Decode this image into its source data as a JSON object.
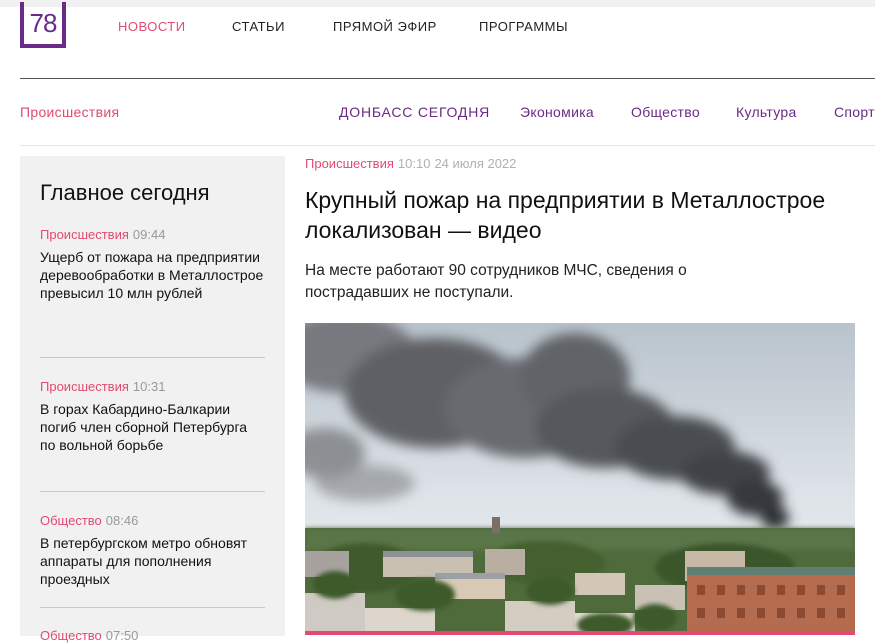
{
  "logo": {
    "text": "78"
  },
  "top_nav": [
    {
      "label": "НОВОСТИ",
      "active": true
    },
    {
      "label": "СТАТЬИ",
      "active": false
    },
    {
      "label": "ПРЯМОЙ ЭФИР",
      "active": false
    },
    {
      "label": "ПРОГРАММЫ",
      "active": false
    }
  ],
  "section_nav": {
    "current": "Происшествия",
    "items": [
      "ДОНБАСС СЕГОДНЯ",
      "Экономика",
      "Общество",
      "Культура",
      "Спорт"
    ]
  },
  "sidebar": {
    "title": "Главное сегодня",
    "items": [
      {
        "category": "Происшествия",
        "time": "09:44",
        "title": "Ущерб от пожара на предприятии деревообработки в Металлострое превысил 10 млн рублей"
      },
      {
        "category": "Происшествия",
        "time": "10:31",
        "title": "В горах Кабардино-Балкарии погиб член сборной Петербурга по вольной борьбе"
      },
      {
        "category": "Общество",
        "time": "08:46",
        "title": "В петербургском метро обновят аппараты для пополнения проездных"
      },
      {
        "category": "Общество",
        "time": "07:50",
        "title": ""
      }
    ]
  },
  "article": {
    "category": "Происшествия",
    "time": "10:10",
    "date": "24 июля 2022",
    "headline": "Крупный пожар на предприятии в Металлострое локализован — видео",
    "lead": "На месте работают 90 сотрудников МЧС, сведения о пострадавших не поступали."
  },
  "colors": {
    "brand_purple": "#6a2a87",
    "accent_pink": "#e24a71"
  }
}
